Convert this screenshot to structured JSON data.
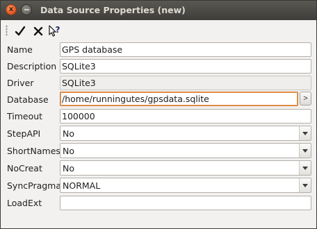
{
  "window": {
    "title": "Data Source Properties (new)",
    "close_glyph": "x"
  },
  "toolbar": {
    "icons": [
      "checkmark-icon",
      "cancel-x-icon",
      "whats-this-help-icon"
    ]
  },
  "form": {
    "name": {
      "label": "Name",
      "value": "GPS database"
    },
    "description": {
      "label": "Description",
      "value": "SQLite3"
    },
    "driver": {
      "label": "Driver",
      "value": "SQLite3"
    },
    "database": {
      "label": "Database",
      "value": "/home/runningutes/gpsdata.sqlite",
      "browse_label": ">"
    },
    "timeout": {
      "label": "Timeout",
      "value": "100000"
    },
    "stepapi": {
      "label": "StepAPI",
      "value": "No"
    },
    "shortnames": {
      "label": "ShortNames",
      "value": "No"
    },
    "nocreat": {
      "label": "NoCreat",
      "value": "No"
    },
    "syncpragma": {
      "label": "SyncPragma",
      "value": "NORMAL"
    },
    "loadext": {
      "label": "LoadExt",
      "value": ""
    }
  },
  "colors": {
    "titlebar": "#3e3d39",
    "close_button": "#e45a22",
    "focus_border": "#d57c36",
    "window_bg": "#f2f1f0"
  }
}
